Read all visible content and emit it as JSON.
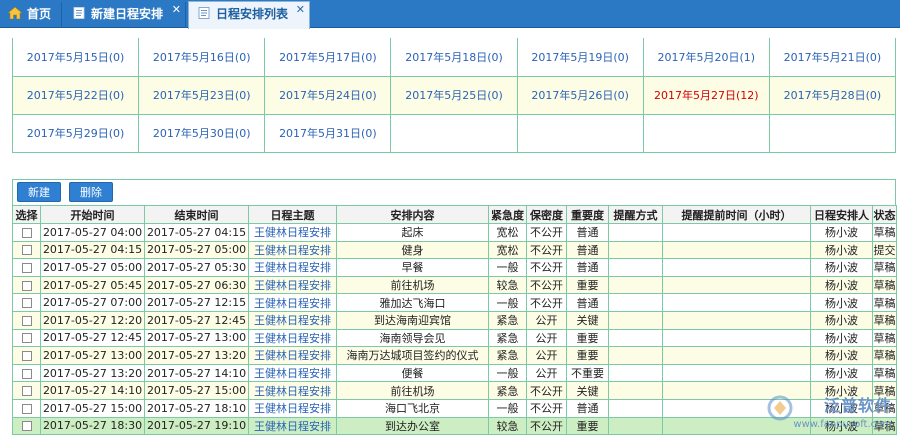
{
  "tabs": [
    {
      "label": "首页",
      "icon": "home-icon"
    },
    {
      "label": "新建日程安排",
      "icon": "document-icon"
    },
    {
      "label": "日程安排列表",
      "icon": "document-icon",
      "active": true
    }
  ],
  "calendar": {
    "rows": [
      [
        "2017年5月15日(0)",
        "2017年5月16日(0)",
        "2017年5月17日(0)",
        "2017年5月18日(0)",
        "2017年5月19日(0)",
        "2017年5月20日(1)",
        "2017年5月21日(0)"
      ],
      [
        "2017年5月22日(0)",
        "2017年5月23日(0)",
        "2017年5月24日(0)",
        "2017年5月25日(0)",
        "2017年5月26日(0)",
        "2017年5月27日(12)",
        "2017年5月28日(0)"
      ],
      [
        "2017年5月29日(0)",
        "2017年5月30日(0)",
        "2017年5月31日(0)",
        "",
        "",
        "",
        ""
      ]
    ],
    "highlight_color": "#d40000"
  },
  "actions": {
    "new_label": "新建",
    "delete_label": "删除"
  },
  "table": {
    "headers": [
      "选择",
      "开始时间",
      "结束时间",
      "日程主题",
      "安排内容",
      "紧急度",
      "保密度",
      "重要度",
      "提醒方式",
      "提醒提前时间（小时）",
      "日程安排人",
      "状态"
    ],
    "rows": [
      [
        "2017-05-27 04:00",
        "2017-05-27 04:15",
        "王健林日程安排",
        "起床",
        "宽松",
        "不公开",
        "普通",
        "",
        "",
        "杨小波",
        "草稿"
      ],
      [
        "2017-05-27 04:15",
        "2017-05-27 05:00",
        "王健林日程安排",
        "健身",
        "宽松",
        "不公开",
        "普通",
        "",
        "",
        "杨小波",
        "提交"
      ],
      [
        "2017-05-27 05:00",
        "2017-05-27 05:30",
        "王健林日程安排",
        "早餐",
        "一般",
        "不公开",
        "普通",
        "",
        "",
        "杨小波",
        "草稿"
      ],
      [
        "2017-05-27 05:45",
        "2017-05-27 06:30",
        "王健林日程安排",
        "前往机场",
        "较急",
        "不公开",
        "重要",
        "",
        "",
        "杨小波",
        "草稿"
      ],
      [
        "2017-05-27 07:00",
        "2017-05-27 12:15",
        "王健林日程安排",
        "雅加达飞海口",
        "一般",
        "不公开",
        "普通",
        "",
        "",
        "杨小波",
        "草稿"
      ],
      [
        "2017-05-27 12:20",
        "2017-05-27 12:45",
        "王健林日程安排",
        "到达海南迎宾馆",
        "紧急",
        "公开",
        "关键",
        "",
        "",
        "杨小波",
        "草稿"
      ],
      [
        "2017-05-27 12:45",
        "2017-05-27 13:00",
        "王健林日程安排",
        "海南领导会见",
        "紧急",
        "公开",
        "重要",
        "",
        "",
        "杨小波",
        "草稿"
      ],
      [
        "2017-05-27 13:00",
        "2017-05-27 13:20",
        "王健林日程安排",
        "海南万达城项目签约的仪式",
        "紧急",
        "公开",
        "重要",
        "",
        "",
        "杨小波",
        "草稿"
      ],
      [
        "2017-05-27 13:20",
        "2017-05-27 14:10",
        "王健林日程安排",
        "便餐",
        "一般",
        "公开",
        "不重要",
        "",
        "",
        "杨小波",
        "草稿"
      ],
      [
        "2017-05-27 14:10",
        "2017-05-27 15:00",
        "王健林日程安排",
        "前往机场",
        "紧急",
        "不公开",
        "关键",
        "",
        "",
        "杨小波",
        "草稿"
      ],
      [
        "2017-05-27 15:00",
        "2017-05-27 18:10",
        "王健林日程安排",
        "海口飞北京",
        "一般",
        "不公开",
        "普通",
        "",
        "",
        "杨小波",
        "草稿"
      ],
      [
        "2017-05-27 18:30",
        "2017-05-27 19:10",
        "王健林日程安排",
        "到达办公室",
        "较急",
        "不公开",
        "重要",
        "",
        "",
        "杨小波",
        "草稿"
      ]
    ]
  },
  "watermark": {
    "title": "泛普软件",
    "url": "www.fanpusoft.com"
  }
}
